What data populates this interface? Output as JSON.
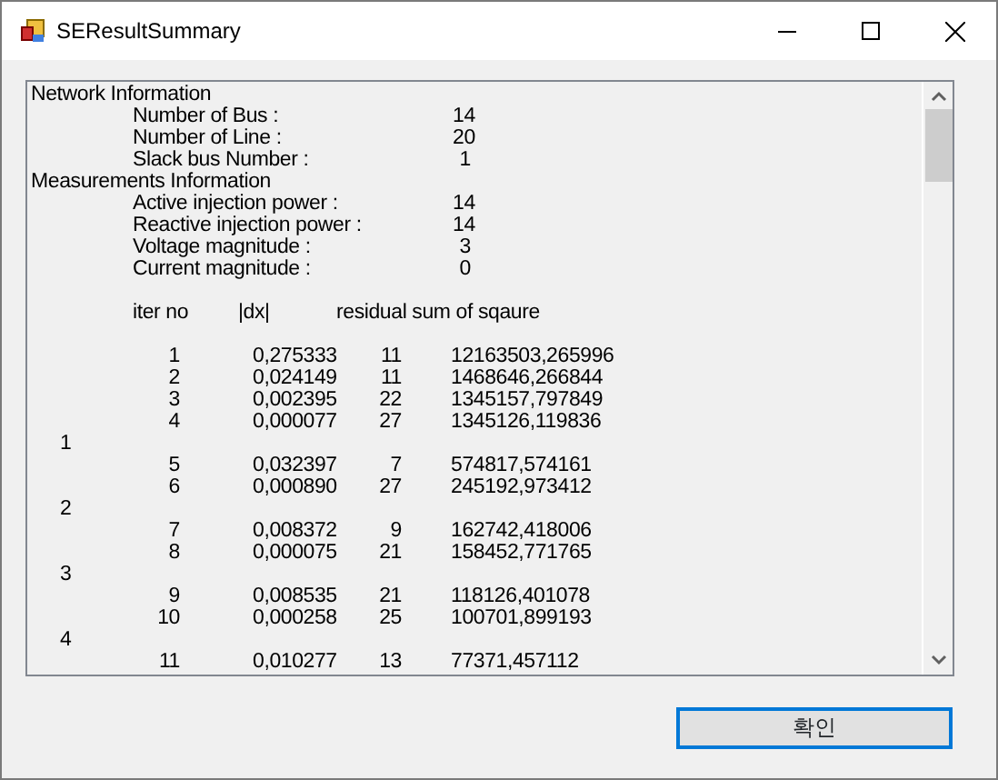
{
  "window": {
    "title": "SEResultSummary"
  },
  "summary": {
    "lines": [
      {
        "kind": "heading",
        "text": "Network Information"
      },
      {
        "kind": "field",
        "label": "Number of Bus :",
        "value": "14"
      },
      {
        "kind": "field",
        "label": "Number of Line :",
        "value": "20"
      },
      {
        "kind": "field",
        "label": "Slack bus Number :",
        "value": "1"
      },
      {
        "kind": "heading",
        "text": "Measurements Information"
      },
      {
        "kind": "field",
        "label": "Active injection power :",
        "value": "14"
      },
      {
        "kind": "field",
        "label": "Reactive injection power :",
        "value": "14"
      },
      {
        "kind": "field",
        "label": "Voltage magnitude :",
        "value": "3"
      },
      {
        "kind": "field",
        "label": "Current magnitude :",
        "value": "0"
      },
      {
        "kind": "blank"
      },
      {
        "kind": "columns",
        "cells": [
          "iter no",
          "|dx|",
          "residual sum of sqaure"
        ]
      },
      {
        "kind": "blank"
      },
      {
        "kind": "row",
        "cells": [
          "1",
          "0,275333",
          "11",
          "12163503,265996"
        ]
      },
      {
        "kind": "row",
        "cells": [
          "2",
          "0,024149",
          "11",
          "1468646,266844"
        ]
      },
      {
        "kind": "row",
        "cells": [
          "3",
          "0,002395",
          "22",
          "1345157,797849"
        ]
      },
      {
        "kind": "row",
        "cells": [
          "4",
          "0,000077",
          "27",
          "1345126,119836"
        ]
      },
      {
        "kind": "group",
        "text": "1"
      },
      {
        "kind": "row",
        "cells": [
          "5",
          "0,032397",
          "7",
          "574817,574161"
        ]
      },
      {
        "kind": "row",
        "cells": [
          "6",
          "0,000890",
          "27",
          "245192,973412"
        ]
      },
      {
        "kind": "group",
        "text": "2"
      },
      {
        "kind": "row",
        "cells": [
          "7",
          "0,008372",
          "9",
          "162742,418006"
        ]
      },
      {
        "kind": "row",
        "cells": [
          "8",
          "0,000075",
          "21",
          "158452,771765"
        ]
      },
      {
        "kind": "group",
        "text": "3"
      },
      {
        "kind": "row",
        "cells": [
          "9",
          "0,008535",
          "21",
          "118126,401078"
        ]
      },
      {
        "kind": "row",
        "cells": [
          "10",
          "0,000258",
          "25",
          "100701,899193"
        ]
      },
      {
        "kind": "group",
        "text": "4"
      },
      {
        "kind": "row",
        "cells": [
          "11",
          "0,010277",
          "13",
          "77371,457112"
        ]
      }
    ]
  },
  "buttons": [
    {
      "label": "확인"
    }
  ]
}
